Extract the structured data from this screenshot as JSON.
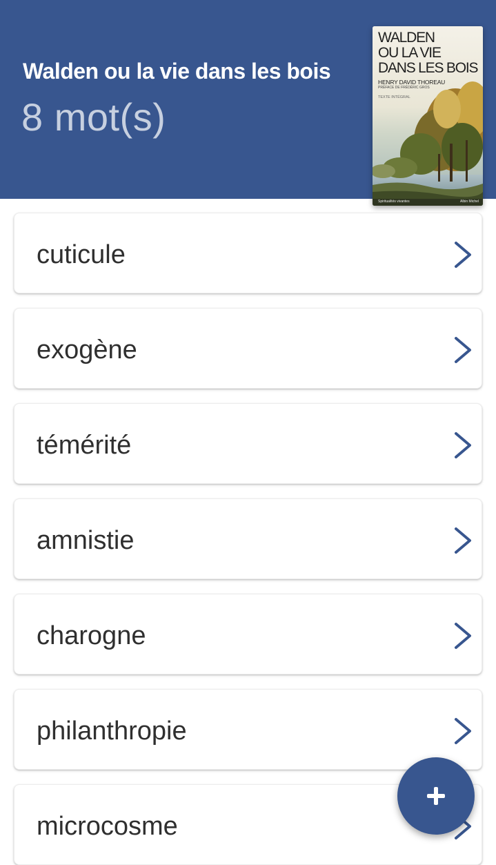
{
  "header": {
    "book_title": "Walden ou la vie dans les bois",
    "word_count": "8 mot(s)",
    "background_color": "#38568f"
  },
  "cover": {
    "title_line1": "WALDEN",
    "title_line2": "OU LA VIE",
    "title_line3": "DANS LES BOIS",
    "author": "HENRY DAVID THOREAU",
    "preface": "PRÉFACE DE FRÉDÉRIC GROS",
    "edition": "TEXTE INTÉGRAL",
    "series": "Spiritualités vivantes",
    "publisher": "Albin Michel"
  },
  "words": [
    {
      "label": "cuticule",
      "icon": "chevron-right-icon"
    },
    {
      "label": "exogène",
      "icon": "chevron-right-icon"
    },
    {
      "label": "témérité",
      "icon": "chevron-right-icon"
    },
    {
      "label": "amnistie",
      "icon": "chevron-right-icon"
    },
    {
      "label": "charogne",
      "icon": "chevron-right-icon"
    },
    {
      "label": "philanthropie",
      "icon": "chevron-right-icon"
    },
    {
      "label": "microcosme",
      "icon": "chevron-right-icon"
    }
  ],
  "fab": {
    "icon": "plus-icon",
    "color": "#38568f"
  }
}
